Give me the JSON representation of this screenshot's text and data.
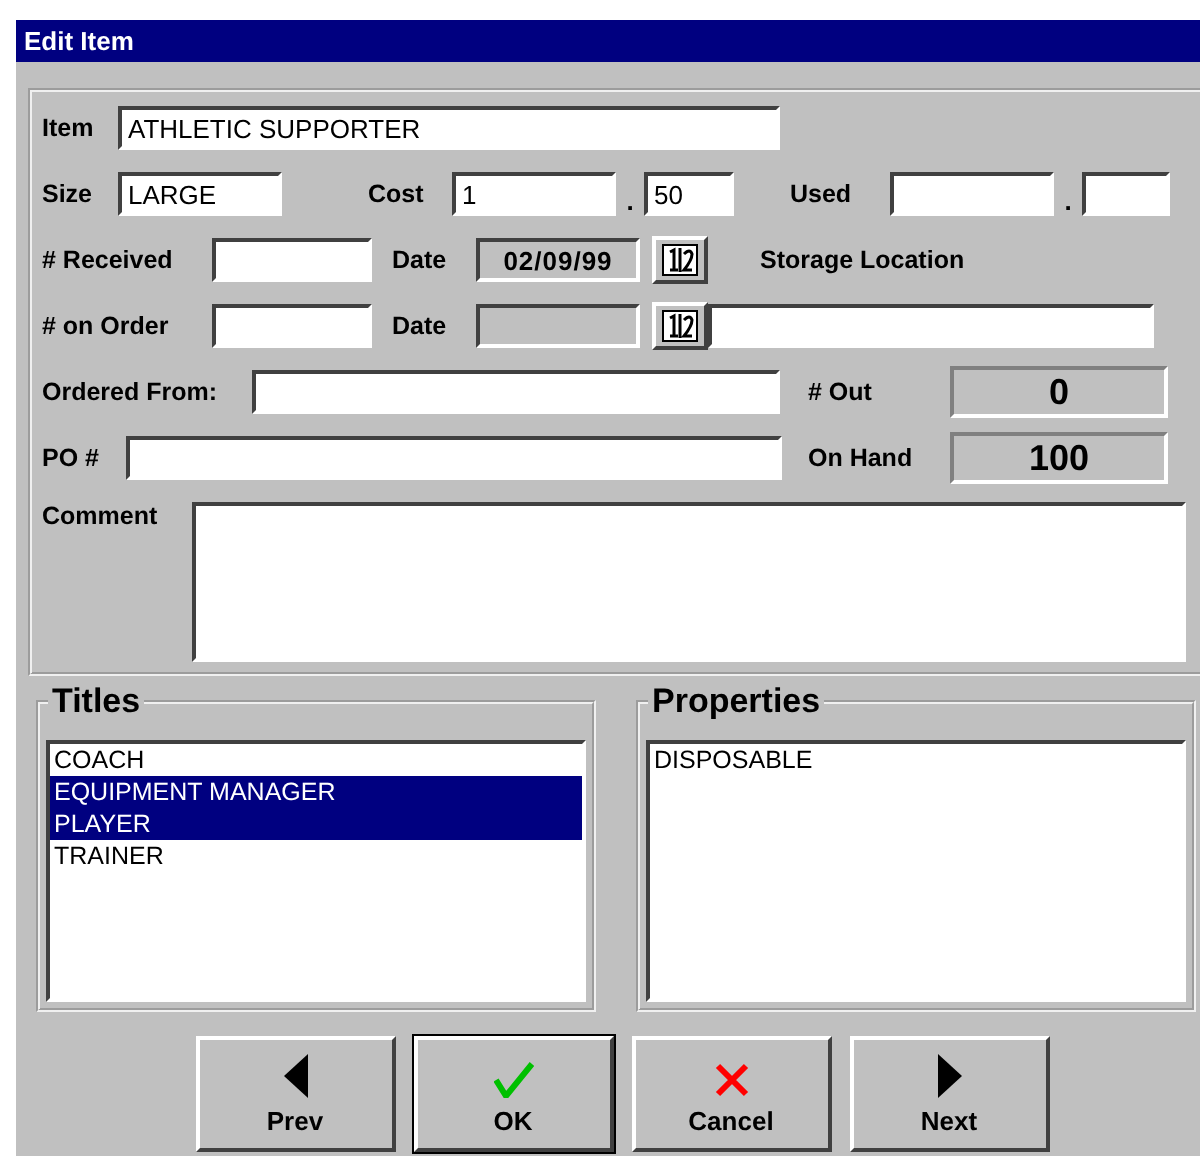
{
  "window": {
    "title": "Edit Item"
  },
  "item": {
    "label": "Item",
    "value": "ATHLETIC SUPPORTER"
  },
  "size": {
    "label": "Size",
    "value": "LARGE"
  },
  "cost": {
    "label": "Cost",
    "value": "1",
    "separator": ".",
    "cents": "50"
  },
  "used": {
    "label": "Used",
    "separator": "."
  },
  "received": {
    "label": "# Received"
  },
  "received_date": {
    "label": "Date",
    "value": "02/09/99"
  },
  "storage_location": {
    "label": "Storage Location"
  },
  "on_order": {
    "label": "# on Order"
  },
  "order_date": {
    "label": "Date"
  },
  "ordered_from": {
    "label": "Ordered From:"
  },
  "out": {
    "label": "# Out",
    "value": "0"
  },
  "po": {
    "label": "PO #"
  },
  "on_hand": {
    "label": "On Hand",
    "value": "100"
  },
  "comment": {
    "label": "Comment"
  },
  "titles": {
    "label": "Titles",
    "items": [
      {
        "text": "COACH",
        "selected": false
      },
      {
        "text": "EQUIPMENT MANAGER",
        "selected": true
      },
      {
        "text": "PLAYER",
        "selected": true
      },
      {
        "text": "TRAINER",
        "selected": false
      }
    ]
  },
  "properties": {
    "label": "Properties",
    "items": [
      {
        "text": "DISPOSABLE",
        "selected": false
      }
    ]
  },
  "buttons": [
    {
      "label": "Prev",
      "kind": "prev"
    },
    {
      "label": "OK",
      "kind": "ok"
    },
    {
      "label": "Cancel",
      "kind": "cancel"
    },
    {
      "label": "Next",
      "kind": "next"
    }
  ]
}
